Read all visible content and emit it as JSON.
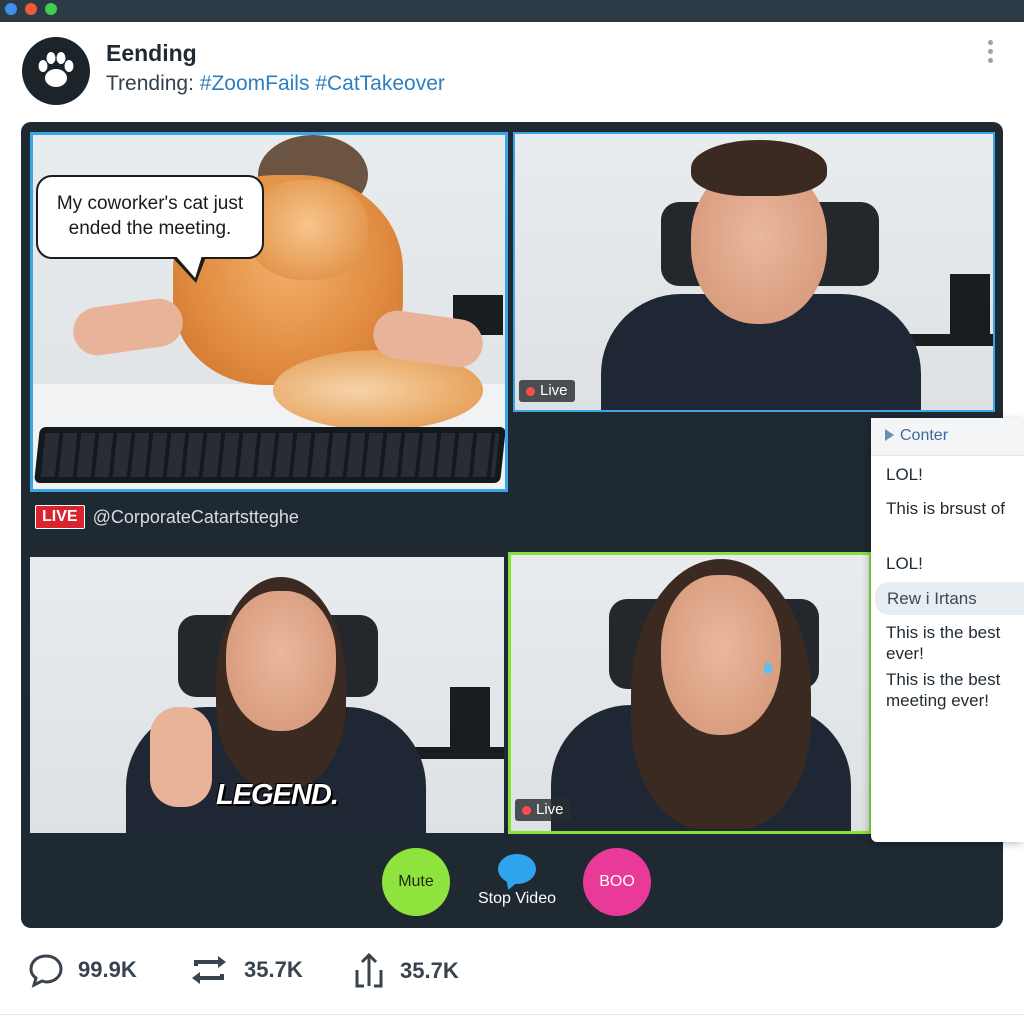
{
  "post": {
    "title": "Eending",
    "trending_prefix": "Trending:",
    "tags": [
      "#ZoomFails",
      "#CatTakeover"
    ]
  },
  "meeting": {
    "caption_bubble": "My coworker's cat just ended the meeting.",
    "tiles": [
      {
        "name": "cat-tile",
        "status": ""
      },
      {
        "name": "man-tile",
        "status": "Live"
      },
      {
        "name": "woman-thumbs-tile",
        "overlay_text": "LEGEND."
      },
      {
        "name": "woman-laughing-tile",
        "status": "Live"
      }
    ],
    "live_badge": "LIVE",
    "handle": "@CorporateCatartstteghe",
    "controls": {
      "mute": "Mute",
      "stop_video": "Stop Video",
      "boo": "BOO"
    }
  },
  "chat": {
    "header": "Conter",
    "messages": [
      "LOL!",
      "This is brsust of",
      "LOL!",
      "Rew i Irtans",
      "This is the best ever!",
      "This is the best meeting ever!"
    ]
  },
  "engagement": {
    "comments": "99.9K",
    "reposts": "35.7K",
    "shares": "35.7K"
  },
  "colors": {
    "titlebar": "#2c3a46",
    "meeting_bg": "#1f2932",
    "accent_blue": "#3aa6e6",
    "accent_green": "#86e23a",
    "mute_button": "#8ee43c",
    "boo_button": "#e93a9a",
    "live_red": "#d9232d",
    "hashtag_blue": "#2e7fc0"
  }
}
